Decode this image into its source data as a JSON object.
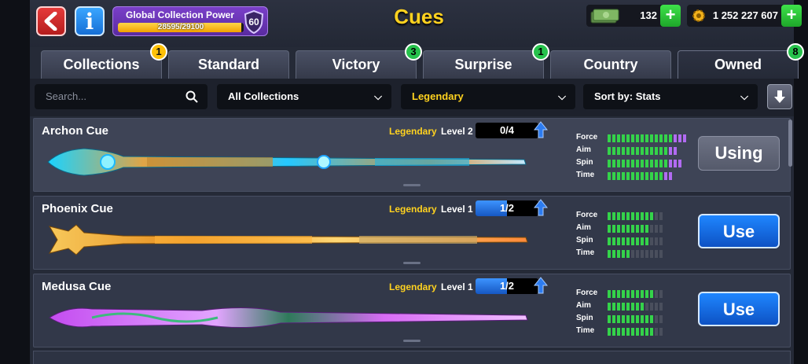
{
  "header": {
    "title": "Cues",
    "collection_power": {
      "label": "Global Collection Power",
      "progress_text": "28595/29100",
      "progress_fraction": 0.9826,
      "level": "60"
    },
    "cash": "132",
    "coins": "1 252 227 607"
  },
  "tabs": [
    {
      "label": "Collections",
      "badge": "1",
      "badge_color": "#ffc107"
    },
    {
      "label": "Standard",
      "badge": null
    },
    {
      "label": "Victory",
      "badge": "3",
      "badge_color": "#27c24c"
    },
    {
      "label": "Surprise",
      "badge": "1",
      "badge_color": "#27c24c"
    },
    {
      "label": "Country",
      "badge": null
    },
    {
      "label": "Owned",
      "badge": "8",
      "badge_color": "#27c24c",
      "active": true
    }
  ],
  "filters": {
    "search_placeholder": "Search...",
    "collection": "All Collections",
    "rarity": "Legendary",
    "sort": "Sort by: Stats"
  },
  "stat_labels": [
    "Force",
    "Aim",
    "Spin",
    "Time"
  ],
  "cues": [
    {
      "name": "Archon Cue",
      "rarity": "Legendary",
      "level": "Level 2",
      "progress": "0/4",
      "progress_fraction": 0,
      "stats": [
        {
          "green": 14,
          "purple": 3
        },
        {
          "green": 13,
          "purple": 2
        },
        {
          "green": 13,
          "purple": 3
        },
        {
          "green": 12,
          "purple": 2
        }
      ],
      "button": "Using",
      "selected": true
    },
    {
      "name": "Phoenix Cue",
      "rarity": "Legendary",
      "level": "Level 1",
      "progress": "1/2",
      "progress_fraction": 0.5,
      "stats": [
        {
          "green": 10,
          "purple": 0
        },
        {
          "green": 9,
          "purple": 0
        },
        {
          "green": 9,
          "purple": 0
        },
        {
          "green": 5,
          "purple": 0
        }
      ],
      "button": "Use",
      "selected": false
    },
    {
      "name": "Medusa Cue",
      "rarity": "Legendary",
      "level": "Level 1",
      "progress": "1/2",
      "progress_fraction": 0.5,
      "stats": [
        {
          "green": 10,
          "purple": 0
        },
        {
          "green": 8,
          "purple": 0
        },
        {
          "green": 10,
          "purple": 0
        },
        {
          "green": 10,
          "purple": 0
        }
      ],
      "button": "Use",
      "selected": false
    }
  ]
}
